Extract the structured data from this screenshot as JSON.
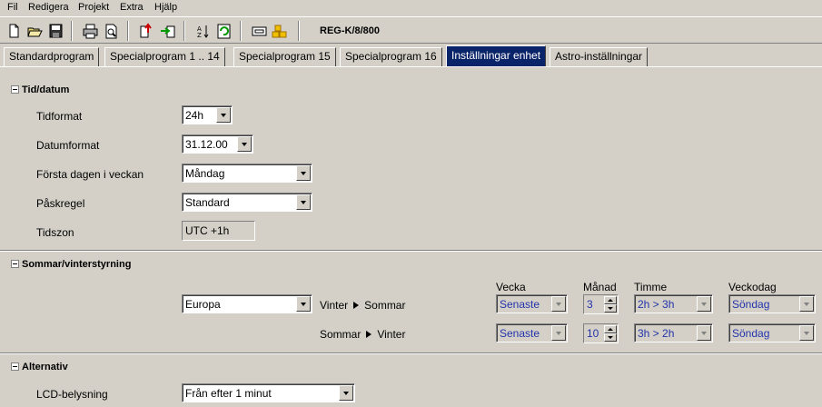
{
  "menu": [
    "Fil",
    "Redigera",
    "Projekt",
    "Extra",
    "Hjälp"
  ],
  "toolbar": {
    "device": "REG-K/8/800"
  },
  "tabs": [
    "Standardprogram",
    "Specialprogram 1 .. 14",
    "Specialprogram 15",
    "Specialprogram 16",
    "Inställningar enhet",
    "Astro-inställningar"
  ],
  "active_tab": "Inställningar enhet",
  "tid": {
    "title": "Tid/datum",
    "tidformat_label": "Tidformat",
    "tidformat": "24h",
    "datumformat_label": "Datumformat",
    "datumformat": "31.12.00",
    "forsta_label": "Första dagen i veckan",
    "forsta": "Måndag",
    "pask_label": "Påskregel",
    "pask": "Standard",
    "tidszon_label": "Tidszon",
    "tidszon": "UTC +1h"
  },
  "sommar": {
    "title": "Sommar/vinterstyrning",
    "region": "Europa",
    "headers": {
      "vecka": "Vecka",
      "manad": "Månad",
      "timme": "Timme",
      "veckodag": "Veckodag"
    },
    "rows": [
      {
        "from": "Vinter",
        "to": "Sommar",
        "vecka": "Senaste",
        "manad": "3",
        "timme": "2h > 3h",
        "veckodag": "Söndag"
      },
      {
        "from": "Sommar",
        "to": "Vinter",
        "vecka": "Senaste",
        "manad": "10",
        "timme": "3h > 2h",
        "veckodag": "Söndag"
      }
    ]
  },
  "alternativ": {
    "title": "Alternativ",
    "lcd_label": "LCD-belysning",
    "lcd": "Från efter 1 minut"
  }
}
